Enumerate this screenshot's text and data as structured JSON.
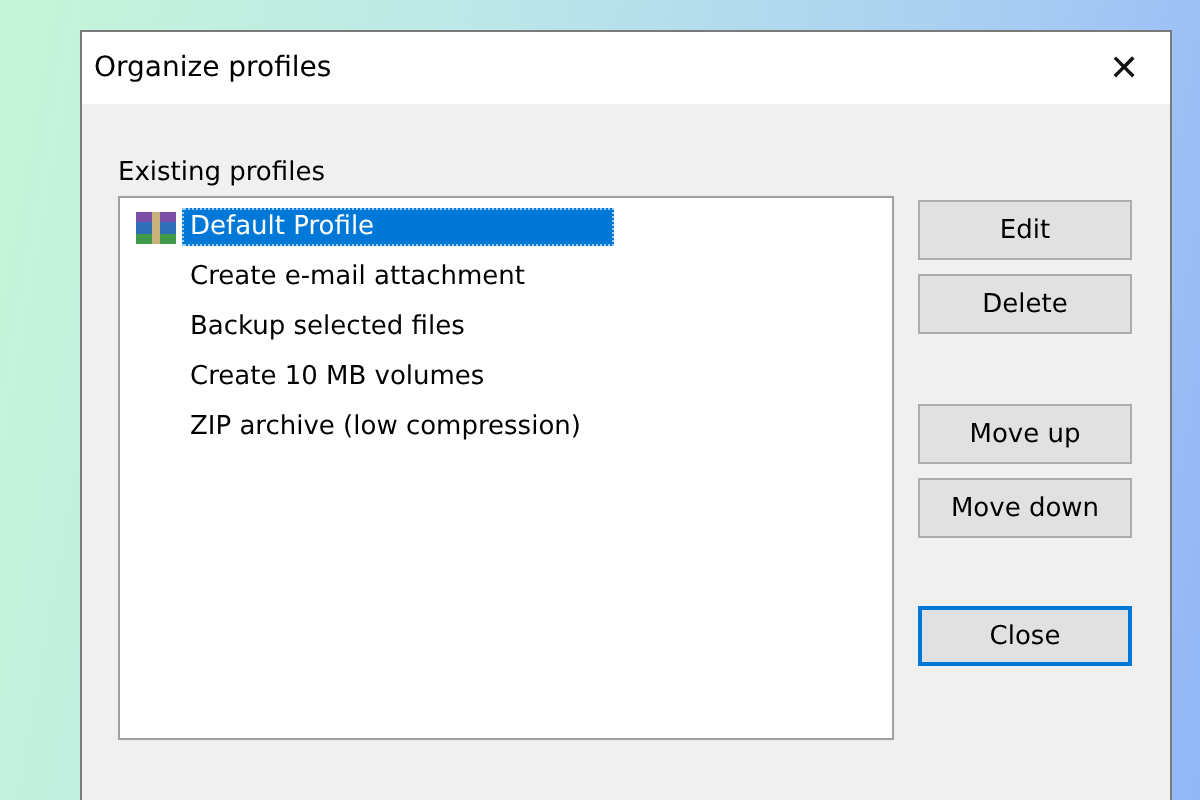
{
  "window": {
    "title": "Organize profiles",
    "close_glyph": "✕"
  },
  "list_label": {
    "text": "Existing profiles"
  },
  "profiles": [
    {
      "name": "Default Profile",
      "selected": true,
      "default": true
    },
    {
      "name": "Create e-mail attachment",
      "selected": false,
      "default": false
    },
    {
      "name": "Backup selected files",
      "selected": false,
      "default": false
    },
    {
      "name": "Create 10 MB volumes",
      "selected": false,
      "default": false
    },
    {
      "name": "ZIP archive (low compression)",
      "selected": false,
      "default": false
    }
  ],
  "buttons": [
    {
      "label": "Edit",
      "focused": false
    },
    {
      "label": "Delete",
      "focused": false
    },
    {
      "label": "Move up",
      "focused": false
    },
    {
      "label": "Move down",
      "focused": false
    },
    {
      "label": "Close",
      "focused": true
    }
  ]
}
